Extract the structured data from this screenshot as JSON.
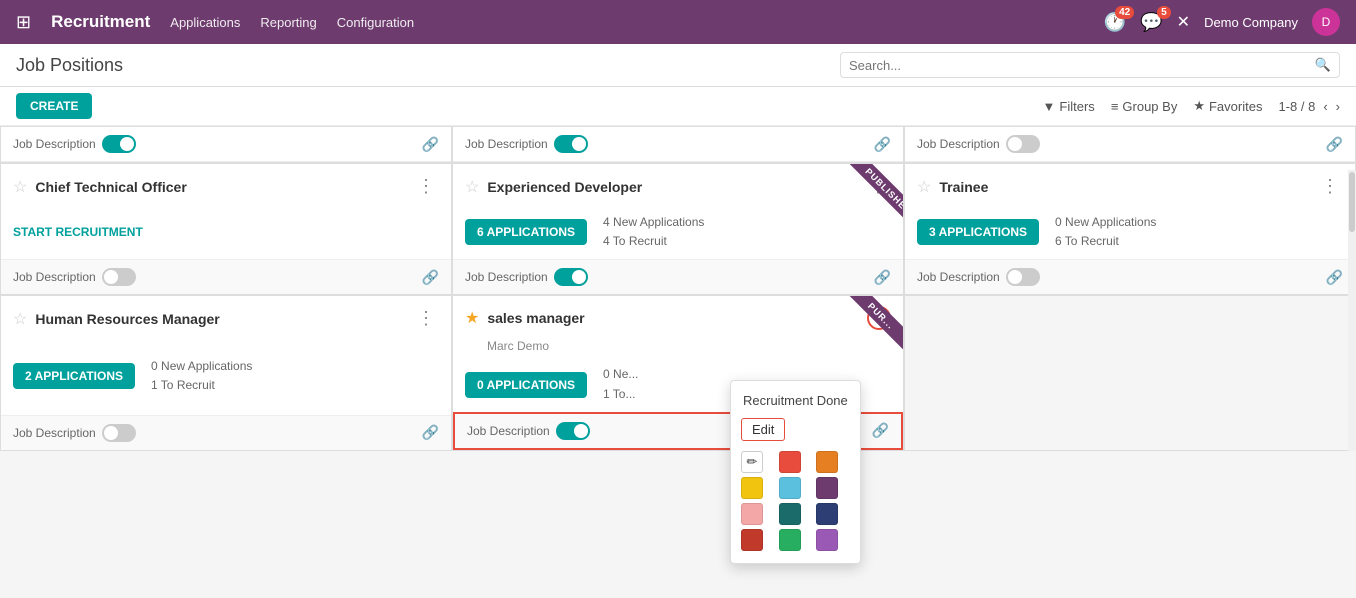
{
  "topnav": {
    "app_grid_icon": "⊞",
    "app_name": "Recruitment",
    "menu_items": [
      "Applications",
      "Reporting",
      "Configuration"
    ],
    "clock_badge": "42",
    "message_badge": "5",
    "close_icon": "✕",
    "company": "Demo Company"
  },
  "subheader": {
    "page_title": "Job Positions",
    "search_placeholder": "Search..."
  },
  "toolbar": {
    "create_label": "CREATE",
    "filters_label": "Filters",
    "groupby_label": "Group By",
    "favorites_label": "Favorites",
    "pagination": "1-8 / 8"
  },
  "cards": [
    {
      "id": "card-1",
      "star": false,
      "title": "Job Description",
      "toggle_on": true,
      "show_link": true,
      "col": 1
    },
    {
      "id": "card-2",
      "star": false,
      "title": "Job Description",
      "toggle_on": true,
      "show_link": true,
      "col": 2
    },
    {
      "id": "card-3",
      "star": false,
      "title": "Job Description",
      "toggle_on": false,
      "show_link": true,
      "col": 3
    }
  ],
  "job_cards": [
    {
      "id": "chief-technical-officer",
      "star": false,
      "title": "Chief Technical Officer",
      "subtitle": "",
      "has_applications_btn": false,
      "start_recruitment": "START RECRUITMENT",
      "applications_count": null,
      "new_applications": null,
      "to_recruit": null,
      "toggle_on": false,
      "show_link": true,
      "published": false,
      "col": 1
    },
    {
      "id": "experienced-developer",
      "star": false,
      "title": "Experienced Developer",
      "subtitle": "",
      "has_applications_btn": true,
      "start_recruitment": null,
      "applications_count": "6 APPLICATIONS",
      "new_applications": "4 New Applications",
      "to_recruit": "4 To Recruit",
      "toggle_on": true,
      "show_link": true,
      "published": true,
      "col": 2
    },
    {
      "id": "trainee",
      "star": false,
      "title": "Trainee",
      "subtitle": "",
      "has_applications_btn": true,
      "start_recruitment": null,
      "applications_count": "3 APPLICATIONS",
      "new_applications": "0 New Applications",
      "to_recruit": "6 To Recruit",
      "toggle_on": false,
      "show_link": true,
      "published": false,
      "col": 3
    },
    {
      "id": "human-resources-manager",
      "star": false,
      "title": "Human Resources Manager",
      "subtitle": "",
      "has_applications_btn": true,
      "start_recruitment": null,
      "applications_count": "2 APPLICATIONS",
      "new_applications": "0 New Applications",
      "to_recruit": "1 To Recruit",
      "toggle_on": false,
      "show_link": true,
      "published": false,
      "col": 1
    },
    {
      "id": "sales-manager",
      "star": true,
      "title": "sales manager",
      "subtitle": "Marc Demo",
      "has_applications_btn": true,
      "start_recruitment": null,
      "applications_count": "0 APPLICATIONS",
      "new_applications": "0 Ne...",
      "to_recruit": "1 To...",
      "toggle_on": true,
      "show_link": true,
      "published": true,
      "col": 2,
      "context_active": true,
      "footer_highlighted": true
    }
  ],
  "context_menu": {
    "title": "Recruitment Done",
    "edit_label": "Edit",
    "colors": [
      {
        "name": "no-color",
        "hex": "#ffffff",
        "is_pen": true
      },
      {
        "name": "red",
        "hex": "#e74c3c"
      },
      {
        "name": "orange",
        "hex": "#e67e22"
      },
      {
        "name": "yellow",
        "hex": "#f1c40f"
      },
      {
        "name": "light-blue",
        "hex": "#5bc0de"
      },
      {
        "name": "purple",
        "hex": "#6d3b6e"
      },
      {
        "name": "pink",
        "hex": "#f4a7a7"
      },
      {
        "name": "teal",
        "hex": "#1a6b6a"
      },
      {
        "name": "dark-blue",
        "hex": "#2c3e73"
      },
      {
        "name": "dark-red",
        "hex": "#c0392b"
      },
      {
        "name": "green",
        "hex": "#27ae60"
      },
      {
        "name": "violet",
        "hex": "#9b59b6"
      }
    ]
  }
}
